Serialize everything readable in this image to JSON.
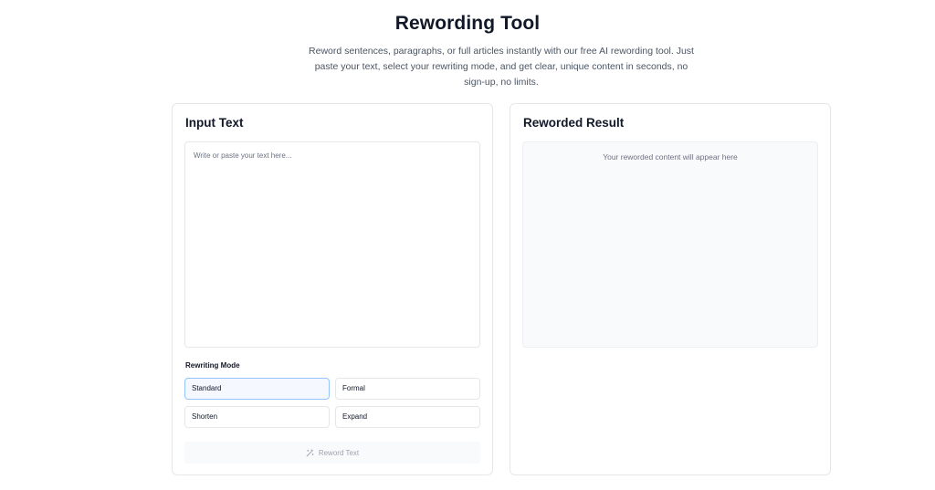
{
  "header": {
    "title": "Rewording Tool",
    "subtitle": "Reword sentences, paragraphs, or full articles instantly with our free AI rewording tool. Just paste your text, select your rewriting mode, and get clear, unique content in seconds, no sign-up, no limits."
  },
  "input_panel": {
    "title": "Input Text",
    "textarea": {
      "placeholder": "Write or paste your text here...",
      "value": ""
    },
    "mode_label": "Rewriting Mode",
    "modes": [
      {
        "label": "Standard",
        "selected": true
      },
      {
        "label": "Formal",
        "selected": false
      },
      {
        "label": "Shorten",
        "selected": false
      },
      {
        "label": "Expand",
        "selected": false
      }
    ],
    "submit": {
      "label": "Reword Text",
      "icon": "magic-wand-icon",
      "disabled": true
    }
  },
  "result_panel": {
    "title": "Reworded Result",
    "placeholder": "Your reworded content will appear here"
  },
  "colors": {
    "selected_border": "#93c5fd",
    "panel_border": "#e5e7eb",
    "result_bg": "#f9fafb"
  }
}
